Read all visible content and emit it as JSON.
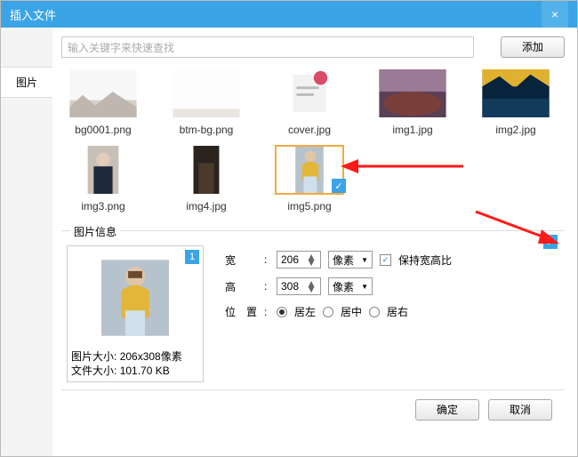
{
  "titlebar": {
    "title": "插入文件",
    "close_glyph": "×"
  },
  "sidebar": {
    "tab_image": "图片"
  },
  "search": {
    "placeholder": "输入关键字来快速查找",
    "add_label": "添加"
  },
  "files": [
    {
      "name": "bg0001.png",
      "selected": false
    },
    {
      "name": "btm-bg.png",
      "selected": false
    },
    {
      "name": "cover.jpg",
      "selected": false
    },
    {
      "name": "img1.jpg",
      "selected": false
    },
    {
      "name": "img2.jpg",
      "selected": false
    },
    {
      "name": "img3.png",
      "selected": false
    },
    {
      "name": "img4.jpg",
      "selected": false
    },
    {
      "name": "img5.png",
      "selected": true
    }
  ],
  "info": {
    "section_title": "图片信息",
    "index_badge": "1",
    "meta_size_label": "图片大小:",
    "meta_size_value": "206x308像素",
    "meta_file_label": "文件大小:",
    "meta_file_value": "101.70 KB",
    "width_label": "宽",
    "width_value": "206",
    "height_label": "高",
    "height_value": "308",
    "unit_label": "像素",
    "keep_ratio_label": "保持宽高比",
    "position_label": "位置",
    "pos_left": "居左",
    "pos_center": "居中",
    "pos_right": "居右",
    "position_value": "居左"
  },
  "footer": {
    "ok": "确定",
    "cancel": "取消"
  }
}
